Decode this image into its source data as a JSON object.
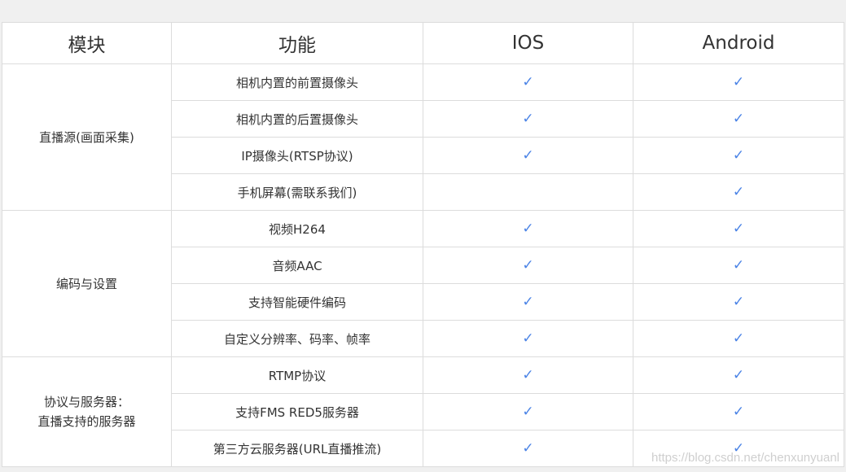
{
  "table": {
    "headers": {
      "module": "模块",
      "feature": "功能",
      "ios": "IOS",
      "android": "Android"
    },
    "check_glyph": "✓",
    "check_color": "#4a83e6",
    "groups": [
      {
        "module_lines": [
          "直播源(画面采集)"
        ],
        "rows": [
          {
            "feature": "相机内置的前置摄像头",
            "ios": true,
            "android": true
          },
          {
            "feature": "相机内置的后置摄像头",
            "ios": true,
            "android": true
          },
          {
            "feature": "IP摄像头(RTSP协议)",
            "ios": true,
            "android": true
          },
          {
            "feature": "手机屏幕(需联系我们)",
            "ios": false,
            "android": true
          }
        ]
      },
      {
        "module_lines": [
          "编码与设置"
        ],
        "rows": [
          {
            "feature": "视频H264",
            "ios": true,
            "android": true
          },
          {
            "feature": "音频AAC",
            "ios": true,
            "android": true
          },
          {
            "feature": "支持智能硬件编码",
            "ios": true,
            "android": true
          },
          {
            "feature": "自定义分辨率、码率、帧率",
            "ios": true,
            "android": true
          }
        ]
      },
      {
        "module_lines": [
          "协议与服务器：",
          "直播支持的服务器"
        ],
        "rows": [
          {
            "feature": "RTMP协议",
            "ios": true,
            "android": true
          },
          {
            "feature": "支持FMS RED5服务器",
            "ios": true,
            "android": true
          },
          {
            "feature": "第三方云服务器(URL直播推流)",
            "ios": true,
            "android": true
          }
        ]
      }
    ]
  },
  "watermark": "https://blog.csdn.net/chenxunyuanl"
}
